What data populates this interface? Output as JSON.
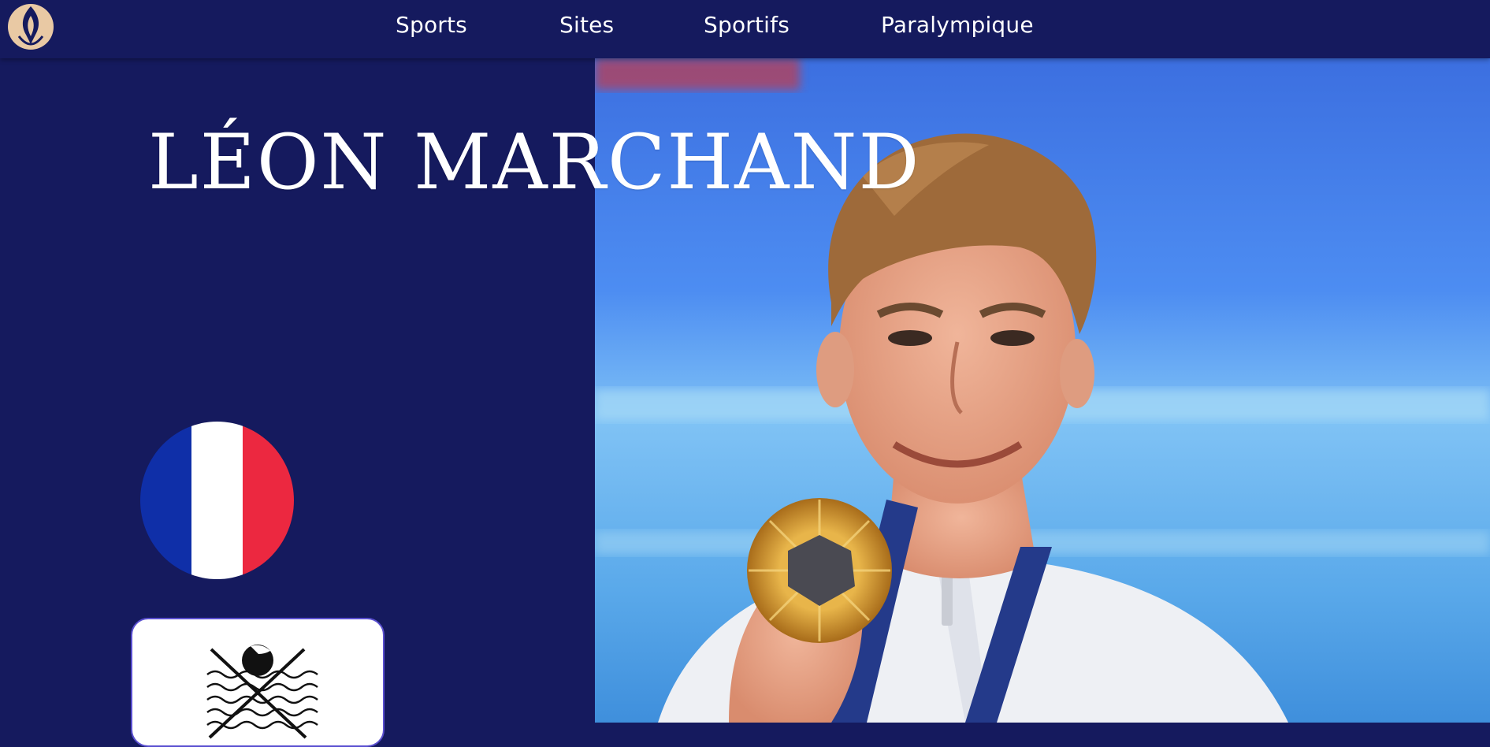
{
  "nav": {
    "items": [
      {
        "label": "Sports"
      },
      {
        "label": "Sites"
      },
      {
        "label": "Sportifs"
      },
      {
        "label": "Paralympique"
      }
    ]
  },
  "athlete": {
    "name": "LÉON MARCHAND"
  },
  "flag": {
    "colors": [
      "#0f2fa8",
      "#ffffff",
      "#ec2840"
    ]
  },
  "icons": {
    "logo": "olympic-flame-icon",
    "sport": "swimming-pictogram-icon"
  },
  "colors": {
    "background": "#151a5e",
    "card_border": "#5a4fd0"
  }
}
